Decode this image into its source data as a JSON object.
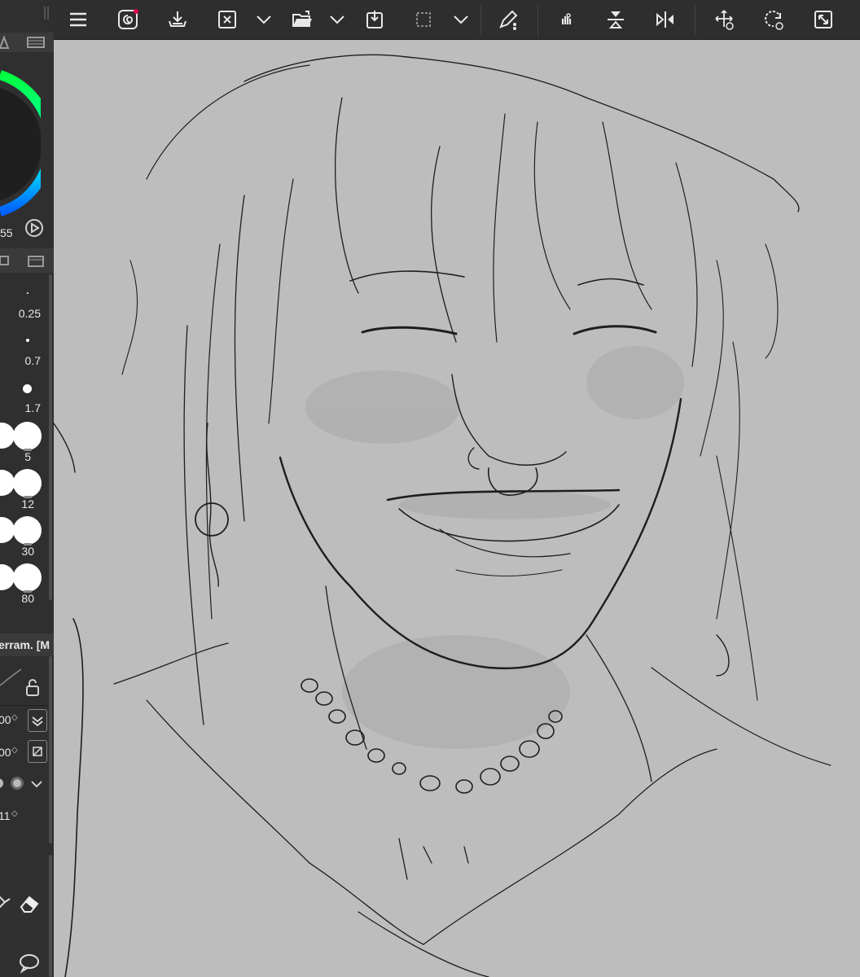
{
  "toolbar": {
    "icons": [
      "menu-icon",
      "clip-studio-icon",
      "save-icon",
      "close-icon",
      "chevron-down-icon",
      "open-folder-icon",
      "chevron-down-icon",
      "import-icon",
      "selection-icon",
      "chevron-down-icon",
      "pen-settings-icon",
      "hand-icon",
      "flip-vertical-icon",
      "flip-horizontal-icon",
      "move-icon",
      "rotate-icon",
      "fullscreen-icon"
    ]
  },
  "color_panel": {
    "value_label": "55"
  },
  "brush_sizes": [
    {
      "label": "0.25"
    },
    {
      "label": "0.7"
    },
    {
      "label": "1.7"
    },
    {
      "label": "5"
    },
    {
      "label": "12"
    },
    {
      "label": "30"
    },
    {
      "label": "80"
    }
  ],
  "tool_property": {
    "tool_name": "erram. [M",
    "field1_value": "00",
    "field2_value": "00",
    "field3_value": "11"
  },
  "colors": {
    "canvas": "#bdbdbd",
    "panel": "#2f2f2f",
    "toolbar": "#2e2e2e",
    "accent_red": "#e0004d"
  }
}
